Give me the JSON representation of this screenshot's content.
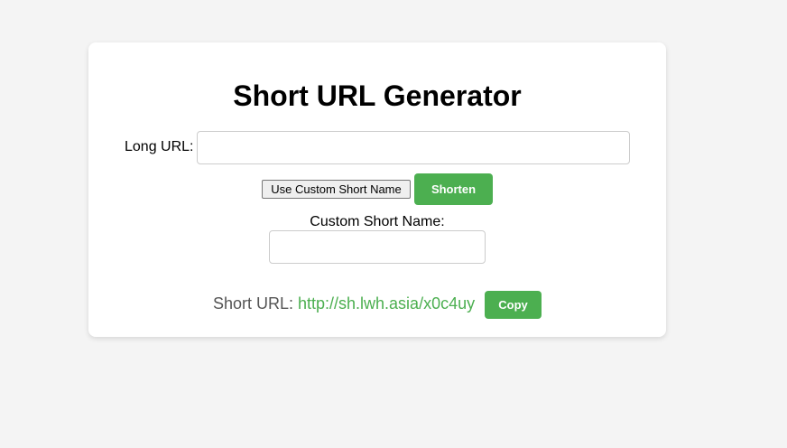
{
  "page": {
    "title": "Short URL Generator"
  },
  "form": {
    "long_url_label": "Long URL:",
    "long_url_value": "",
    "long_url_placeholder": "",
    "custom_toggle_label": "Use Custom Short Name",
    "shorten_label": "Shorten",
    "custom_name_label": "Custom Short Name:",
    "custom_name_value": "",
    "custom_name_placeholder": ""
  },
  "result": {
    "label": "Short URL:",
    "url": "http://sh.lwh.asia/x0c4uy",
    "copy_label": "Copy"
  },
  "colors": {
    "background": "#f4f4f4",
    "card": "#ffffff",
    "accent": "#4caf50",
    "result_label": "#555555"
  }
}
